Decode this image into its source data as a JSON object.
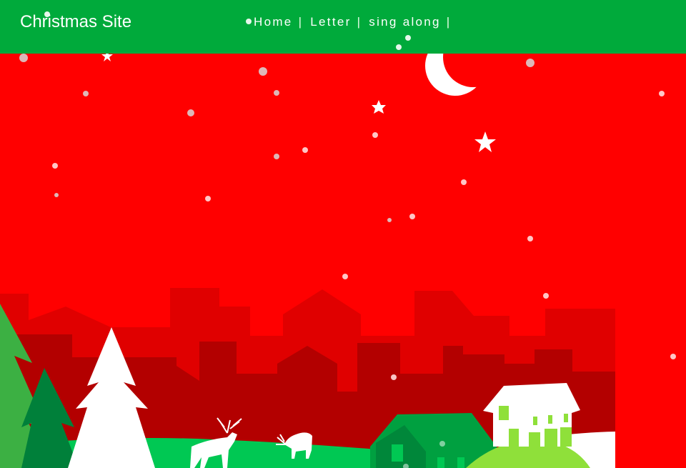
{
  "header": {
    "site_title": "Christmas Site",
    "nav": [
      {
        "label": "Home",
        "separator": "|"
      },
      {
        "label": "Letter",
        "separator": "|"
      },
      {
        "label": "sing along",
        "separator": "|"
      }
    ]
  },
  "colors": {
    "header_bg": "#00aa3b",
    "sky": "#ff0000",
    "city_far": "#e00000",
    "city_near": "#b30000",
    "hill": "#00c853",
    "tree_dark": "#00803a",
    "tree_mid": "#3cb043",
    "house_light": "#8fe03a",
    "snow": "#ffffff"
  },
  "scene_icons": [
    "moon-icon",
    "star-icon",
    "pine-tree-icon",
    "reindeer-icon",
    "house-icon"
  ]
}
